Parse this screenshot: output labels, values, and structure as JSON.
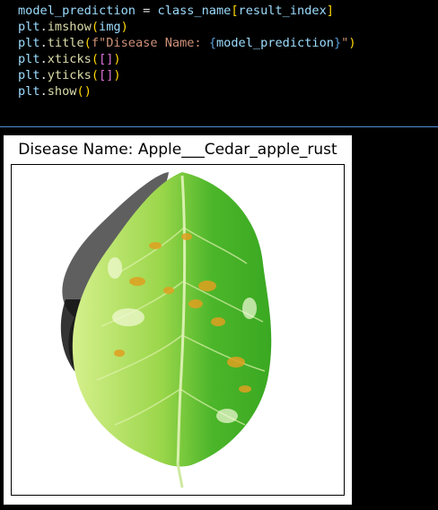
{
  "code": {
    "line1": {
      "var": "model_prediction",
      "op": " = ",
      "obj": "class_name",
      "open": "[",
      "idx": "result_index",
      "close": "]"
    },
    "line2": {
      "mod": "plt",
      "dot": ".",
      "fn": "imshow",
      "open": "(",
      "arg": "img",
      "close": ")"
    },
    "line3": {
      "mod": "plt",
      "dot": ".",
      "fn": "title",
      "open": "(",
      "str_prefix": "f\"Disease Name: ",
      "brace_open": "{",
      "interp": "model_prediction",
      "brace_close": "}",
      "str_suffix": "\"",
      "close": ")"
    },
    "line4": {
      "mod": "plt",
      "dot": ".",
      "fn": "xticks",
      "open": "(",
      "inner_open": "[",
      "inner_close": "]",
      "close": ")"
    },
    "line5": {
      "mod": "plt",
      "dot": ".",
      "fn": "yticks",
      "open": "(",
      "inner_open": "[",
      "inner_close": "]",
      "close": ")"
    },
    "line6": {
      "mod": "plt",
      "dot": ".",
      "fn": "show",
      "open": "(",
      "close": ")"
    }
  },
  "output": {
    "title": "Disease Name: Apple___Cedar_apple_rust"
  },
  "colors": {
    "background": "#000000",
    "divider": "#4f8fd6",
    "leaf_light": "#c8ec7a",
    "leaf_dark": "#2e9e1e",
    "rust_spot": "#e0a020"
  }
}
